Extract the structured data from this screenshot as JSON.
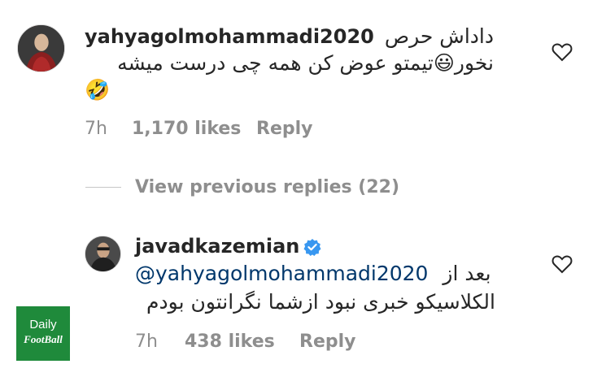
{
  "comment1": {
    "username": "yahyagolmohammadi2020",
    "text_line1_suffix": "داداش حرص",
    "text_line2": "نخور😃تیمتو عوض کن همه چی درست میشه",
    "text_line3": "🤣",
    "time": "7h",
    "likes": "1,170 likes",
    "reply_label": "Reply",
    "avatar_icon": "profile-avatar"
  },
  "view_replies": {
    "label": "View previous replies (22)"
  },
  "comment2": {
    "username": "javadkazemian",
    "verified_icon": "verified-badge-icon",
    "mention": "@yahyagolmohammadi2020",
    "text_line1_suffix": "بعد از",
    "text_line2": "الکلاسیکو خبری نبود ازشما نگرانتون بودم",
    "time": "7h",
    "likes": "438 likes",
    "reply_label": "Reply"
  },
  "logo": {
    "line1": "Daily",
    "line2": "FootBall"
  },
  "colors": {
    "text": "#262626",
    "muted": "#8e8e8e",
    "mention": "#00376b",
    "verified": "#3897f0",
    "logo_bg": "#1f8a3b"
  }
}
